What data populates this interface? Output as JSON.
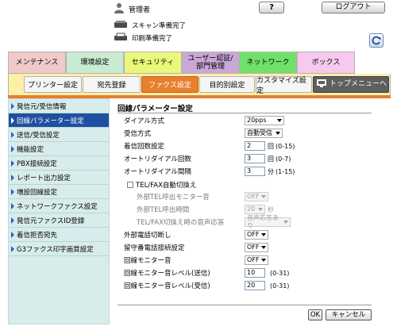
{
  "header": {
    "user_label": "管理者",
    "help_label": "?",
    "logout_label": "ログアウト",
    "scan_status": "スキャン準備完了",
    "print_status": "印刷準備完了"
  },
  "main_tabs": [
    {
      "label": "メンテナンス",
      "color": "#f1c9c9"
    },
    {
      "label": "環境設定",
      "color": "#c9ebd2"
    },
    {
      "label": "セキュリティ",
      "color": "#e9f77a"
    },
    {
      "label": "ユーザー認証/部門管理",
      "color": "#c9a8d8"
    },
    {
      "label": "ネットワーク",
      "color": "#6fe06a"
    },
    {
      "label": "ボックス",
      "color": "#f7c9ee"
    }
  ],
  "sub_tabs": [
    {
      "label": "プリンター設定"
    },
    {
      "label": "宛先登録"
    },
    {
      "label": "ファクス設定"
    },
    {
      "label": "目的別設定"
    },
    {
      "label": "カスタマイズ設定"
    },
    {
      "label": "トップメニューへ"
    }
  ],
  "sidebar": {
    "items": [
      {
        "label": "発信元/受信情報"
      },
      {
        "label": "回線パラメーター設定"
      },
      {
        "label": "送信/受信設定"
      },
      {
        "label": "機能設定"
      },
      {
        "label": "PBX接続設定"
      },
      {
        "label": "レポート出力設定"
      },
      {
        "label": "増設回線設定"
      },
      {
        "label": "ネットワークファクス設定"
      },
      {
        "label": "発信元ファクスID登録"
      },
      {
        "label": "着信拒否宛先"
      },
      {
        "label": "G3ファクス印字画質設定"
      }
    ]
  },
  "content": {
    "title": "回線パラメーター設定",
    "fields": {
      "dial_method": {
        "label": "ダイアル方式",
        "value": "20pps"
      },
      "receive_mode": {
        "label": "受信方式",
        "value": "自動受信"
      },
      "incoming_rings": {
        "label": "着信回数設定",
        "value": "2",
        "unit": "回",
        "range": "(0-15)"
      },
      "auto_redial_count": {
        "label": "オートリダイアル回数",
        "value": "3",
        "unit": "回",
        "range": "(0-7)"
      },
      "auto_redial_interval": {
        "label": "オートリダイアル間隔",
        "value": "3",
        "unit": "分",
        "range": "(1-15)"
      },
      "tel_fax_switch": {
        "label": "TEL/FAX自動切換え"
      },
      "ext_tel_monitor": {
        "label": "外部TEL呼出モニター音",
        "value": "OFF"
      },
      "ext_tel_call_time": {
        "label": "外部TEL呼出時間",
        "value": "20",
        "unit": "秒"
      },
      "tel_fax_voice": {
        "label": "TEL/FAX切換え時の音声応答",
        "value": "音声応答あり"
      },
      "ext_phone_disconnect": {
        "label": "外部電話切断し",
        "value": "OFF"
      },
      "answering_machine": {
        "label": "留守番電話接続設定",
        "value": "OFF"
      },
      "line_monitor": {
        "label": "回線モニター音",
        "value": "OFF"
      },
      "monitor_send": {
        "label": "回線モニター音レベル(送信)",
        "value": "10",
        "range": "(0-31)"
      },
      "monitor_receive": {
        "label": "回線モニター音レベル(受信)",
        "value": "20",
        "range": "(0-31)"
      }
    },
    "ok_label": "OK",
    "cancel_label": "キャンセル"
  }
}
